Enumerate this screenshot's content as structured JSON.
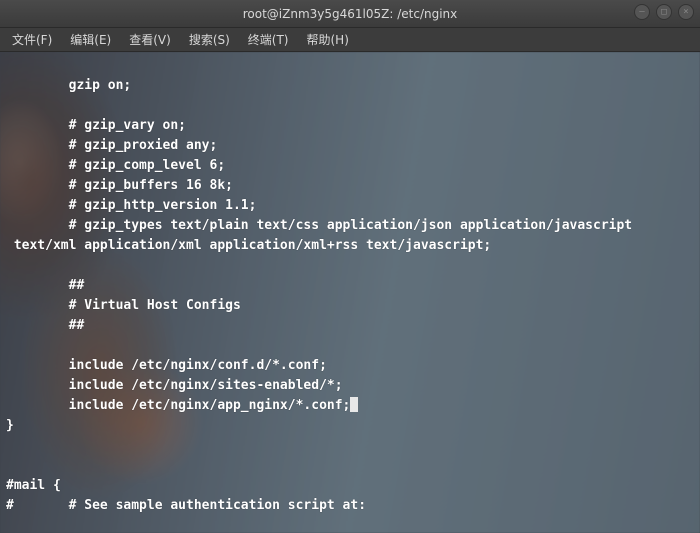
{
  "titlebar": {
    "title": "root@iZnm3y5g461l05Z: /etc/nginx"
  },
  "window_controls": {
    "minimize": "–",
    "maximize": "□",
    "close": "×"
  },
  "menubar": {
    "items": [
      "文件(F)",
      "编辑(E)",
      "查看(V)",
      "搜索(S)",
      "终端(T)",
      "帮助(H)"
    ]
  },
  "terminal_lines": [
    "",
    "        gzip on;",
    "",
    "        # gzip_vary on;",
    "        # gzip_proxied any;",
    "        # gzip_comp_level 6;",
    "        # gzip_buffers 16 8k;",
    "        # gzip_http_version 1.1;",
    "        # gzip_types text/plain text/css application/json application/javascript",
    " text/xml application/xml application/xml+rss text/javascript;",
    "",
    "        ##",
    "        # Virtual Host Configs",
    "        ##",
    "",
    "        include /etc/nginx/conf.d/*.conf;",
    "        include /etc/nginx/sites-enabled/*;",
    "        include /etc/nginx/app_nginx/*.conf;",
    "}",
    "",
    "",
    "#mail {",
    "#       # See sample authentication script at:"
  ],
  "cursor_line_index": 17
}
